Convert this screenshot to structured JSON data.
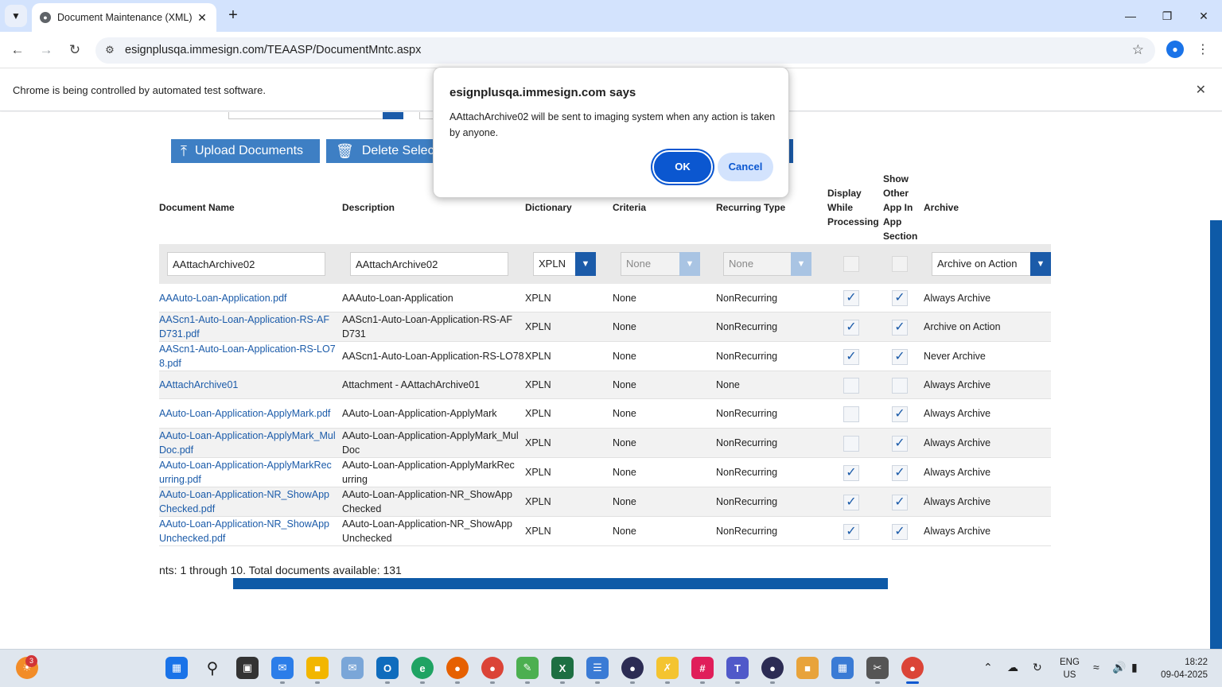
{
  "browser": {
    "tab_title": "Document Maintenance (XML)",
    "url": "esignplusqa.immesign.com/TEAASP/DocumentMntc.aspx",
    "infobar_text": "Chrome is being controlled by automated test software."
  },
  "toolbar": {
    "upload_label": "Upload Documents",
    "delete_label": "Delete Selected"
  },
  "table": {
    "headers": {
      "document_name": "Document Name",
      "description": "Description",
      "dictionary": "Dictionary",
      "criteria": "Criteria",
      "recurring_type": "Recurring Type",
      "display_while_processing": "Display While Processing",
      "show_other_app": "Show Other App In App Section",
      "archive": "Archive"
    },
    "filter": {
      "document_name": "AAttachArchive02",
      "description": "AAttachArchive02",
      "dictionary": "XPLN",
      "criteria": "None",
      "recurring_type": "None",
      "archive": "Archive on Action"
    },
    "rows": [
      {
        "name": "AAAuto-Loan-Application.pdf",
        "description": "AAAuto-Loan-Application",
        "dictionary": "XPLN",
        "criteria": "None",
        "recurring": "NonRecurring",
        "display": true,
        "show": true,
        "archive": "Always Archive"
      },
      {
        "name": "AAScn1-Auto-Loan-Application-RS-AFD731.pdf",
        "description": "AAScn1-Auto-Loan-Application-RS-AFD731",
        "dictionary": "XPLN",
        "criteria": "None",
        "recurring": "NonRecurring",
        "display": true,
        "show": true,
        "archive": "Archive on Action"
      },
      {
        "name": "AAScn1-Auto-Loan-Application-RS-LO78.pdf",
        "description": "AAScn1-Auto-Loan-Application-RS-LO78",
        "dictionary": "XPLN",
        "criteria": "None",
        "recurring": "NonRecurring",
        "display": true,
        "show": true,
        "archive": "Never Archive"
      },
      {
        "name": "AAttachArchive01",
        "description": "Attachment - AAttachArchive01",
        "dictionary": "XPLN",
        "criteria": "None",
        "recurring": "None",
        "display": false,
        "show": false,
        "archive": "Always Archive"
      },
      {
        "name": "AAuto-Loan-Application-ApplyMark.pdf",
        "description": "AAuto-Loan-Application-ApplyMark",
        "dictionary": "XPLN",
        "criteria": "None",
        "recurring": "NonRecurring",
        "display": false,
        "show": true,
        "archive": "Always Archive"
      },
      {
        "name": "AAuto-Loan-Application-ApplyMark_MulDoc.pdf",
        "description": "AAuto-Loan-Application-ApplyMark_MulDoc",
        "dictionary": "XPLN",
        "criteria": "None",
        "recurring": "NonRecurring",
        "display": false,
        "show": true,
        "archive": "Always Archive"
      },
      {
        "name": "AAuto-Loan-Application-ApplyMarkRecurring.pdf",
        "description": "AAuto-Loan-Application-ApplyMarkRecurring",
        "dictionary": "XPLN",
        "criteria": "None",
        "recurring": "NonRecurring",
        "display": true,
        "show": true,
        "archive": "Always Archive"
      },
      {
        "name": "AAuto-Loan-Application-NR_ShowAppChecked.pdf",
        "description": "AAuto-Loan-Application-NR_ShowAppChecked",
        "dictionary": "XPLN",
        "criteria": "None",
        "recurring": "NonRecurring",
        "display": true,
        "show": true,
        "archive": "Always Archive"
      },
      {
        "name": "AAuto-Loan-Application-NR_ShowAppUnchecked.pdf",
        "description": "AAuto-Loan-Application-NR_ShowAppUnchecked",
        "dictionary": "XPLN",
        "criteria": "None",
        "recurring": "NonRecurring",
        "display": true,
        "show": true,
        "archive": "Always Archive"
      }
    ]
  },
  "pager": {
    "text": "nts: 1 through 10. Total documents available: 131"
  },
  "dialog": {
    "title": "esignplusqa.immesign.com says",
    "message": "AAttachArchive02 will be sent to imaging system when any action is taken by anyone.",
    "ok_label": "OK",
    "cancel_label": "Cancel"
  },
  "taskbar": {
    "notification_count": "3",
    "lang_top": "ENG",
    "lang_bottom": "US",
    "time": "18:22",
    "date": "09-04-2025"
  },
  "colors": {
    "accent_blue": "#1b5ba9",
    "button_blue": "#3e7fc4",
    "dialog_ok": "#0b57d0"
  }
}
